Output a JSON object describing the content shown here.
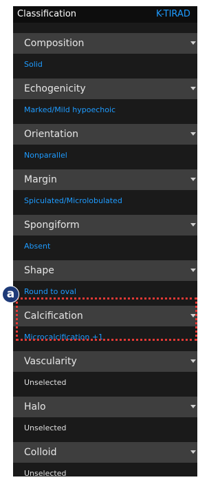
{
  "header": {
    "title": "Classification",
    "system": "K-TIRAD"
  },
  "items": [
    {
      "label": "Composition",
      "value": "Solid",
      "selected": true
    },
    {
      "label": "Echogenicity",
      "value": "Marked/Mild hypoechoic",
      "selected": true
    },
    {
      "label": "Orientation",
      "value": "Nonparallel",
      "selected": true
    },
    {
      "label": "Margin",
      "value": "Spiculated/Microlobulated",
      "selected": true
    },
    {
      "label": "Spongiform",
      "value": "Absent",
      "selected": true
    },
    {
      "label": "Shape",
      "value": "Round to oval",
      "selected": true
    },
    {
      "label": "Calcification",
      "value": "Microcalcification +1",
      "selected": true
    },
    {
      "label": "Vascularity",
      "value": "Unselected",
      "selected": false
    },
    {
      "label": "Halo",
      "value": "Unselected",
      "selected": false
    },
    {
      "label": "Colloid",
      "value": "Unselected",
      "selected": false
    }
  ],
  "annotation": {
    "marker_label": "a",
    "highlighted_item": "Calcification"
  },
  "colors": {
    "selected_value": "#1e9bff",
    "unselected_value": "#e0e0e0",
    "highlight": "#e53935",
    "marker": "#1e3a78"
  }
}
